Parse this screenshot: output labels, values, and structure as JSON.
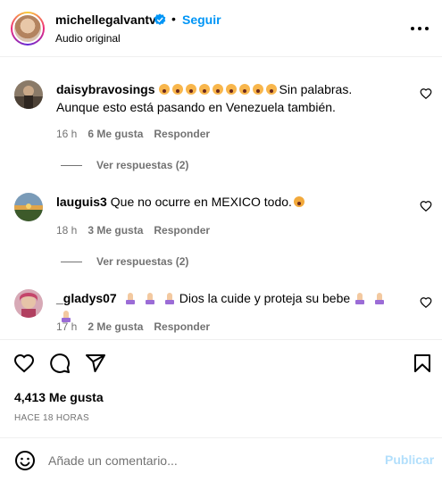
{
  "header": {
    "username": "michellegalvantv",
    "separator": "•",
    "follow_label": "Seguir",
    "subtitle": "Audio original"
  },
  "comments": [
    {
      "username": "daisybravosings",
      "emoji_count": 9,
      "text": "Sin palabras. Aunque esto está pasando en Venezuela también.",
      "time": "16 h",
      "likes": "6 Me gusta",
      "reply_label": "Responder",
      "view_replies": "Ver respuestas (2)"
    },
    {
      "username": "lauguis3",
      "text": "Que no ocurre en MEXICO todo.",
      "time": "18 h",
      "likes": "3 Me gusta",
      "reply_label": "Responder",
      "view_replies": "Ver respuestas (2)"
    },
    {
      "username": "_gladys07",
      "text": "Dios la cuide y proteja su bebe",
      "time": "17 h",
      "likes": "2 Me gusta",
      "reply_label": "Responder"
    }
  ],
  "post": {
    "likes": "4,413 Me gusta",
    "time_ago": "HACE 18 HORAS"
  },
  "add_comment": {
    "placeholder": "Añade un comentario...",
    "publish_label": "Publicar"
  },
  "icons": [
    "verified-badge-icon",
    "more-options-icon",
    "heart-icon",
    "comment-icon",
    "share-icon",
    "save-icon",
    "emoji-icon"
  ],
  "colors": {
    "link": "#0095f6",
    "muted": "#737373",
    "publish_disabled": "#b2dffc",
    "divider": "#efefef"
  }
}
